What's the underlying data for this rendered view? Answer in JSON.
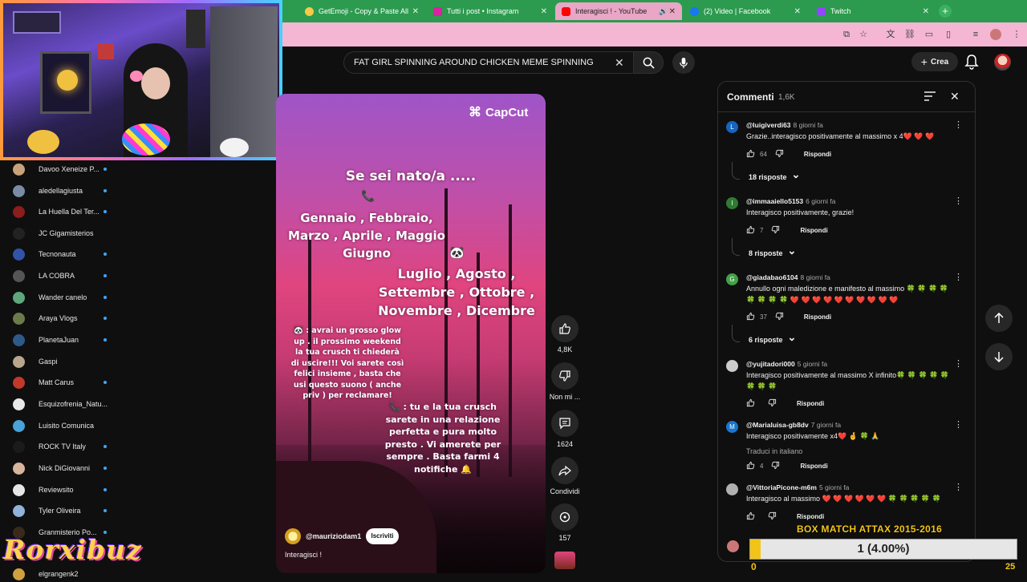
{
  "tabs": [
    {
      "title": "GetEmoji - Copy & Paste All",
      "favicon_color": "#f7c948",
      "active": false
    },
    {
      "title": "Tutti i post • Instagram",
      "favicon_color": "#d6249f",
      "active": false
    },
    {
      "title": "Interagisci ! - YouTube",
      "favicon_color": "#ff0000",
      "active": true
    },
    {
      "title": "(2) Video | Facebook",
      "favicon_color": "#1877f2",
      "active": false
    },
    {
      "title": "Twitch",
      "favicon_color": "#9146ff",
      "active": false
    }
  ],
  "search": {
    "query": "FAT GIRL SPINNING AROUND CHICKEN MEME SPINNING"
  },
  "header": {
    "create_label": "Crea"
  },
  "sidebar": {
    "subscriptions": [
      {
        "name": "Davoo Xeneize P...",
        "color": "#c8a27a",
        "new": true
      },
      {
        "name": "aledellagiusta",
        "color": "#7a8ca5",
        "new": true
      },
      {
        "name": "La Huella Del Ter...",
        "color": "#8b1d1d",
        "new": true
      },
      {
        "name": "JC Gigamisterios",
        "color": "#222222",
        "new": false
      },
      {
        "name": "Tecnonauta",
        "color": "#3153a8",
        "new": true
      },
      {
        "name": "LA COBRA",
        "color": "#555555",
        "new": true
      },
      {
        "name": "Wander canelo",
        "color": "#5fa67b",
        "new": true
      },
      {
        "name": "Araya Vlogs",
        "color": "#6b7a4a",
        "new": true
      },
      {
        "name": "PlanetaJuan",
        "color": "#2e5a8a",
        "new": true
      },
      {
        "name": "Gaspi",
        "color": "#b9a48e",
        "new": false
      },
      {
        "name": "Matt Carus",
        "color": "#c0392b",
        "new": true
      },
      {
        "name": "Esquizofrenia_Natu...",
        "color": "#e8e8e8",
        "new": false
      },
      {
        "name": "Luisito Comunica",
        "color": "#49a2d8",
        "new": false
      },
      {
        "name": "ROCK TV Italy",
        "color": "#1b1b1b",
        "new": true
      },
      {
        "name": "Nick DiGiovanni",
        "color": "#d7b49e",
        "new": true
      },
      {
        "name": "Reviewsito",
        "color": "#e6e6e6",
        "new": true
      },
      {
        "name": "Tyler Oliveira",
        "color": "#8fb3d9",
        "new": true
      },
      {
        "name": "Granmisterio Po...",
        "color": "#3a2a1a",
        "new": true
      },
      {
        "name": "elgrangenk2",
        "color": "#d0a040",
        "new": false
      }
    ]
  },
  "video": {
    "watermark": "CapCut",
    "heading": "Se sei nato/a .....",
    "months_a": "Gennaio , Febbraio,\nMarzo , Aprile , Maggio\nGiugno",
    "months_b": "Luglio , Agosto ,\nSettembre , Ottobre ,\nNovembre , Dicembre",
    "caption_a": "🐼 : avrai un grosso glow up . il prossimo weekend la tua crusch ti chiederà di uscire!!! Voi sarete così felici insieme , basta che usi questo suono ( anche priv ) per reclamare!",
    "caption_b": "📞 : tu e la tua crusch sarete in una relazione perfetta e pura molto presto . Vi amerete per sempre . Basta farmi 4 notifiche 🔔",
    "channel": "@mauriziodam1",
    "subscribe_label": "Iscriviti",
    "title": "Interagisci !"
  },
  "actions": {
    "likes": "4,8K",
    "dislike_label": "Non mi ...",
    "comments_count": "1624",
    "share_label": "Condividi",
    "remix_count": "157"
  },
  "comments_panel": {
    "title": "Commenti",
    "count": "1,6K",
    "reply_label": "Rispondi",
    "comments": [
      {
        "initial": "L",
        "color": "#1565c0",
        "user": "@luigiverdi63",
        "time": "8 giorni fa",
        "text": "Grazie..interagisco positivamente al massimo x 4❤️ ❤️ ❤️",
        "likes": "64",
        "replies": "18 risposte"
      },
      {
        "initial": "I",
        "color": "#2e7d32",
        "user": "@immaaiello5153",
        "time": "6 giorni fa",
        "text": "Interagisco positivamente, grazie!",
        "likes": "7",
        "replies": "8 risposte"
      },
      {
        "initial": "G",
        "color": "#43a047",
        "user": "@giadabao6104",
        "time": "8 giorni fa",
        "text": "Annullo ogni maledizione e manifesto al massimo 🍀 🍀 🍀 🍀 🍀 🍀 🍀 🍀 ❤️ ❤️ ❤️ ❤️ ❤️ ❤️ ❤️ ❤️ ❤️ ❤️",
        "likes": "37",
        "replies": "6 risposte"
      },
      {
        "initial": "",
        "color": "#cccccc",
        "user": "@yujitadori000",
        "time": "5 giorni fa",
        "text": "Interagisco positivamente al massimo X infinito🍀 🍀 🍀 🍀 🍀 🍀 🍀 🍀",
        "likes": "",
        "replies": ""
      },
      {
        "initial": "M",
        "color": "#1976d2",
        "user": "@Marialuisa-gb8dv",
        "time": "7 giorni fa",
        "text": "Interagisco positivamente x4❤️ 🤞 🍀 🙏",
        "translate": "Traduci in italiano",
        "likes": "4",
        "replies": ""
      },
      {
        "initial": "",
        "color": "#b0b0b0",
        "user": "@VittoriaPicone-m6m",
        "time": "5 giorni fa",
        "text": "Interagisco al massimo ❤️ ❤️ ❤️ ❤️ ❤️ ❤️ 🍀 🍀 🍀 🍀 🍀",
        "likes": "",
        "replies": ""
      }
    ]
  },
  "overlay": {
    "logo": "Rorxibuz",
    "box_title": "BOX MATCH ATTAX 2015-2016",
    "progress_label": "1 (4.00%)",
    "progress_fraction": 0.04,
    "min": "0",
    "max": "25"
  }
}
